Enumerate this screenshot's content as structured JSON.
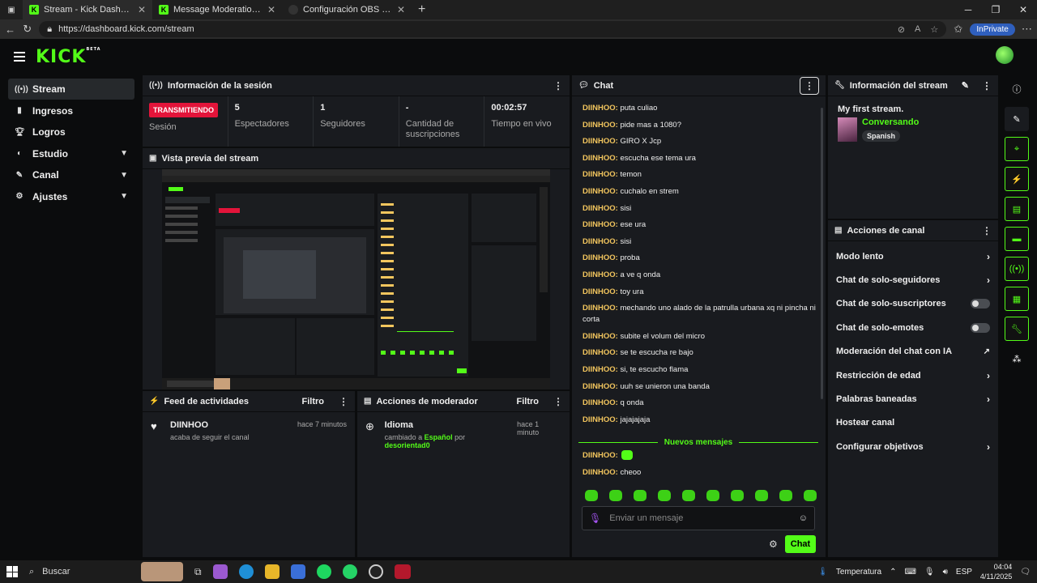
{
  "browser": {
    "tabs": [
      {
        "title": "Stream - Kick Dashboard",
        "icon": "kick-icon",
        "active": true
      },
      {
        "title": "Message Moderation - Kick Dashb",
        "icon": "kick-icon",
        "active": false
      },
      {
        "title": "Configuración OBS para PC baja",
        "icon": "obs-icon",
        "active": false
      }
    ],
    "url": "https://dashboard.kick.com/stream",
    "inprivate": "InPrivate"
  },
  "nav": {
    "items": [
      {
        "label": "Stream",
        "icon": "broadcast-icon",
        "active": true,
        "has_chevron": false
      },
      {
        "label": "Ingresos",
        "icon": "chart-icon",
        "active": false,
        "has_chevron": false
      },
      {
        "label": "Logros",
        "icon": "trophy-icon",
        "active": false,
        "has_chevron": false
      },
      {
        "label": "Estudio",
        "icon": "palette-icon",
        "active": false,
        "has_chevron": true
      },
      {
        "label": "Canal",
        "icon": "pencil-icon",
        "active": false,
        "has_chevron": true
      },
      {
        "label": "Ajustes",
        "icon": "gear-icon",
        "active": false,
        "has_chevron": true
      }
    ]
  },
  "session": {
    "title": "Información de la sesión",
    "badge": "TRANSMITIENDO",
    "stats": [
      {
        "value": "",
        "label": "Sesión"
      },
      {
        "value": "5",
        "label": "Espectadores"
      },
      {
        "value": "1",
        "label": "Seguidores"
      },
      {
        "value": "-",
        "label": "Cantidad de suscripciones"
      },
      {
        "value": "00:02:57",
        "label": "Tiempo en vivo"
      }
    ]
  },
  "preview": {
    "title": "Vista previa del stream"
  },
  "activity": {
    "title": "Feed de actividades",
    "filter": "Filtro",
    "items": [
      {
        "user": "DIINHOO",
        "text": "acaba de seguir el canal",
        "time": "hace 7 minutos"
      }
    ]
  },
  "modactions": {
    "title": "Acciones de moderador",
    "filter": "Filtro",
    "items": [
      {
        "title": "Idioma",
        "prefix": "cambiado a",
        "value": "Español",
        "mid": "por",
        "user": "desorientad0",
        "time": "hace 1 minuto"
      }
    ]
  },
  "chat": {
    "title": "Chat",
    "messages": [
      {
        "user": "DIINHOO:",
        "text": "puta culiao"
      },
      {
        "user": "DIINHOO:",
        "text": "pide mas a 1080?"
      },
      {
        "user": "DIINHOO:",
        "text": "GIRO X Jcp"
      },
      {
        "user": "DIINHOO:",
        "text": "escucha ese tema ura"
      },
      {
        "user": "DIINHOO:",
        "text": "temon"
      },
      {
        "user": "DIINHOO:",
        "text": "cuchalo en strem"
      },
      {
        "user": "DIINHOO:",
        "text": "sisi"
      },
      {
        "user": "DIINHOO:",
        "text": "ese ura"
      },
      {
        "user": "DIINHOO:",
        "text": "sisi"
      },
      {
        "user": "DIINHOO:",
        "text": "proba"
      },
      {
        "user": "DIINHOO:",
        "text": "a ve q onda"
      },
      {
        "user": "DIINHOO:",
        "text": "toy ura"
      },
      {
        "user": "DIINHOO:",
        "text": "mechando uno alado de la patrulla urbana xq ni pincha ni corta"
      },
      {
        "user": "DIINHOO:",
        "text": "subite el volum del micro"
      },
      {
        "user": "DIINHOO:",
        "text": "se te escucha re bajo"
      },
      {
        "user": "DIINHOO:",
        "text": "si, te escucho flama"
      },
      {
        "user": "DIINHOO:",
        "text": "uuh se unieron una banda"
      },
      {
        "user": "DIINHOO:",
        "text": "q onda"
      },
      {
        "user": "DIINHOO:",
        "text": "jajajajaja"
      }
    ],
    "new_label": "Nuevos mensajes",
    "new_messages": [
      {
        "user": "DIINHOO:",
        "text": ""
      },
      {
        "user": "DIINHOO:",
        "text": "cheoo"
      }
    ],
    "placeholder": "Enviar un mensaje",
    "send": "Chat"
  },
  "stream_info": {
    "title": "Información del stream",
    "stream_title": "My first stream.",
    "category": "Conversando",
    "tag": "Spanish"
  },
  "channel_actions": {
    "title": "Acciones de canal",
    "items": [
      {
        "label": "Modo lento",
        "control": "chevron"
      },
      {
        "label": "Chat de solo-seguidores",
        "control": "chevron"
      },
      {
        "label": "Chat de solo-suscriptores",
        "control": "toggle"
      },
      {
        "label": "Chat de solo-emotes",
        "control": "toggle"
      },
      {
        "label": "Moderación del chat con IA",
        "control": "external"
      },
      {
        "label": "Restricción de edad",
        "control": "chevron"
      },
      {
        "label": "Palabras baneadas",
        "control": "chevron"
      },
      {
        "label": "Hostear canal",
        "control": "none"
      },
      {
        "label": "Configurar objetivos",
        "control": "chevron"
      }
    ]
  },
  "taskbar": {
    "search": "Buscar",
    "weather": "Temperatura",
    "lang": "ESP",
    "time": "04:04",
    "date": "4/11/2025"
  },
  "colors": {
    "accent": "#53fc18",
    "live": "#e3143a",
    "chat_user": "#f3c65e"
  }
}
